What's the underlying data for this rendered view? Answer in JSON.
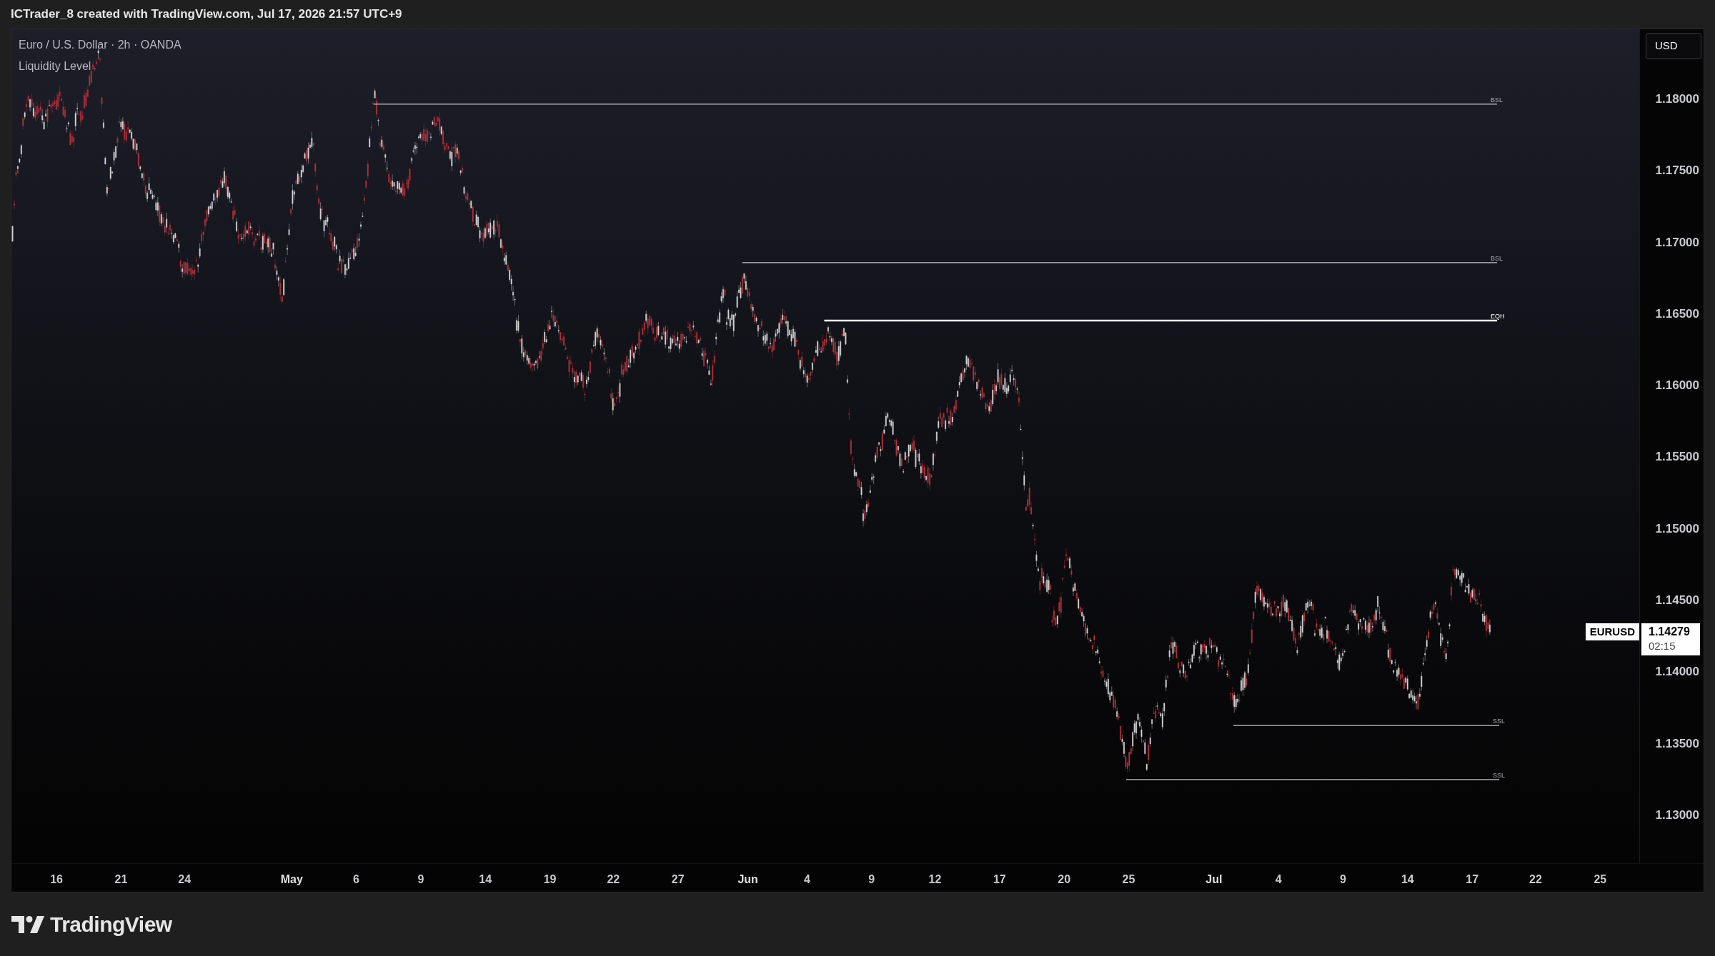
{
  "header": {
    "caption": "ICTrader_8 created with TradingView.com, Jul 17, 2026 21:57 UTC+9"
  },
  "chart": {
    "symbol_title": "Euro / U.S. Dollar · 2h · OANDA",
    "indicator": "Liquidity Level",
    "currency_button": "USD",
    "levels": [
      {
        "kind": "thin",
        "label": "BSL"
      },
      {
        "kind": "thin",
        "label": "BSL"
      },
      {
        "kind": "thick",
        "label": "EQH"
      },
      {
        "kind": "thin",
        "label": "SSL"
      },
      {
        "kind": "thin",
        "label": "SSL"
      }
    ],
    "price_ticks": [
      "1.18000",
      "1.17500",
      "1.17000",
      "1.16500",
      "1.16000",
      "1.15500",
      "1.15000",
      "1.14500",
      "1.14000",
      "1.13500",
      "1.13000"
    ],
    "time_labels": [
      {
        "label": "16",
        "month": false
      },
      {
        "label": "21",
        "month": false
      },
      {
        "label": "24",
        "month": false
      },
      {
        "label": "May",
        "month": true
      },
      {
        "label": "6",
        "month": false
      },
      {
        "label": "9",
        "month": false
      },
      {
        "label": "14",
        "month": false
      },
      {
        "label": "19",
        "month": false
      },
      {
        "label": "22",
        "month": false
      },
      {
        "label": "27",
        "month": false
      },
      {
        "label": "Jun",
        "month": true
      },
      {
        "label": "4",
        "month": false
      },
      {
        "label": "9",
        "month": false
      },
      {
        "label": "12",
        "month": false
      },
      {
        "label": "17",
        "month": false
      },
      {
        "label": "20",
        "month": false
      },
      {
        "label": "25",
        "month": false
      },
      {
        "label": "Jul",
        "month": true
      },
      {
        "label": "4",
        "month": false
      },
      {
        "label": "9",
        "month": false
      },
      {
        "label": "14",
        "month": false
      },
      {
        "label": "17",
        "month": false
      },
      {
        "label": "22",
        "month": false
      },
      {
        "label": "25",
        "month": false
      }
    ],
    "last_price": {
      "symbol": "EURUSD",
      "price": "1.14279",
      "countdown": "02:15"
    }
  },
  "footer": {
    "brand": "TradingView"
  }
}
